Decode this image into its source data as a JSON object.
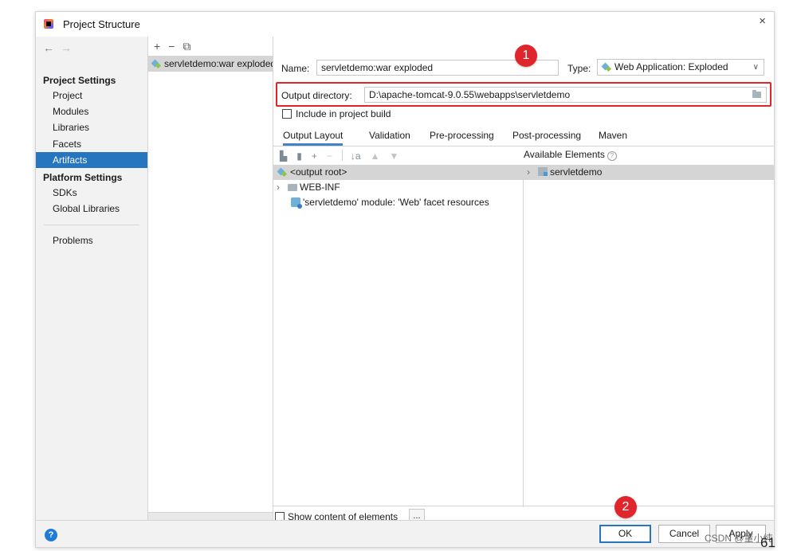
{
  "window": {
    "title": "Project Structure",
    "close_glyph": "×"
  },
  "nav": {
    "back_glyph": "←",
    "forward_glyph": "→",
    "project_settings_header": "Project Settings",
    "project_settings_items": [
      "Project",
      "Modules",
      "Libraries",
      "Facets",
      "Artifacts"
    ],
    "selected_item": "Artifacts",
    "platform_settings_header": "Platform Settings",
    "platform_settings_items": [
      "SDKs",
      "Global Libraries"
    ],
    "problems_label": "Problems"
  },
  "artifacts_list": {
    "add_glyph": "+",
    "remove_glyph": "−",
    "copy_glyph": "⧉",
    "items": [
      "servletdemo:war exploded"
    ]
  },
  "artifact": {
    "name_label": "Name:",
    "name_value": "servletdemo:war exploded",
    "type_label": "Type:",
    "type_value": "Web Application: Exploded",
    "output_dir_label": "Output directory:",
    "output_dir_value": "D:\\apache-tomcat-9.0.55\\webapps\\servletdemo",
    "include_in_build_label": "Include in project build",
    "include_in_build_checked": false
  },
  "tabs": [
    "Output Layout",
    "Validation",
    "Pre-processing",
    "Post-processing",
    "Maven"
  ],
  "active_tab": "Output Layout",
  "layout_toolbar": {
    "new_folder_icon": "folder-plus-icon",
    "new_archive_icon": "archive-icon",
    "add_glyph": "+",
    "remove_glyph": "−",
    "sort_glyph": "↓a",
    "up_glyph": "▲",
    "down_glyph": "▼"
  },
  "available_elements_label": "Available Elements",
  "output_tree": {
    "root_label": "<output root>",
    "children": [
      "WEB-INF",
      "'servletdemo' module: 'Web' facet resources"
    ]
  },
  "available_tree": {
    "items": [
      "servletdemo"
    ]
  },
  "show_content_label": "Show content of elements",
  "ellipsis_label": "...",
  "annotations": {
    "badge_1": "1",
    "badge_2": "2"
  },
  "footer": {
    "help_glyph": "?",
    "ok_label": "OK",
    "cancel_label": "Cancel",
    "apply_label": "Apply"
  },
  "watermark": "CSDN @董小纯",
  "partial_text": "61",
  "colors": {
    "selection": "#2675bf",
    "highlight": "#e0262d",
    "tab_underline": "#4083c9"
  }
}
